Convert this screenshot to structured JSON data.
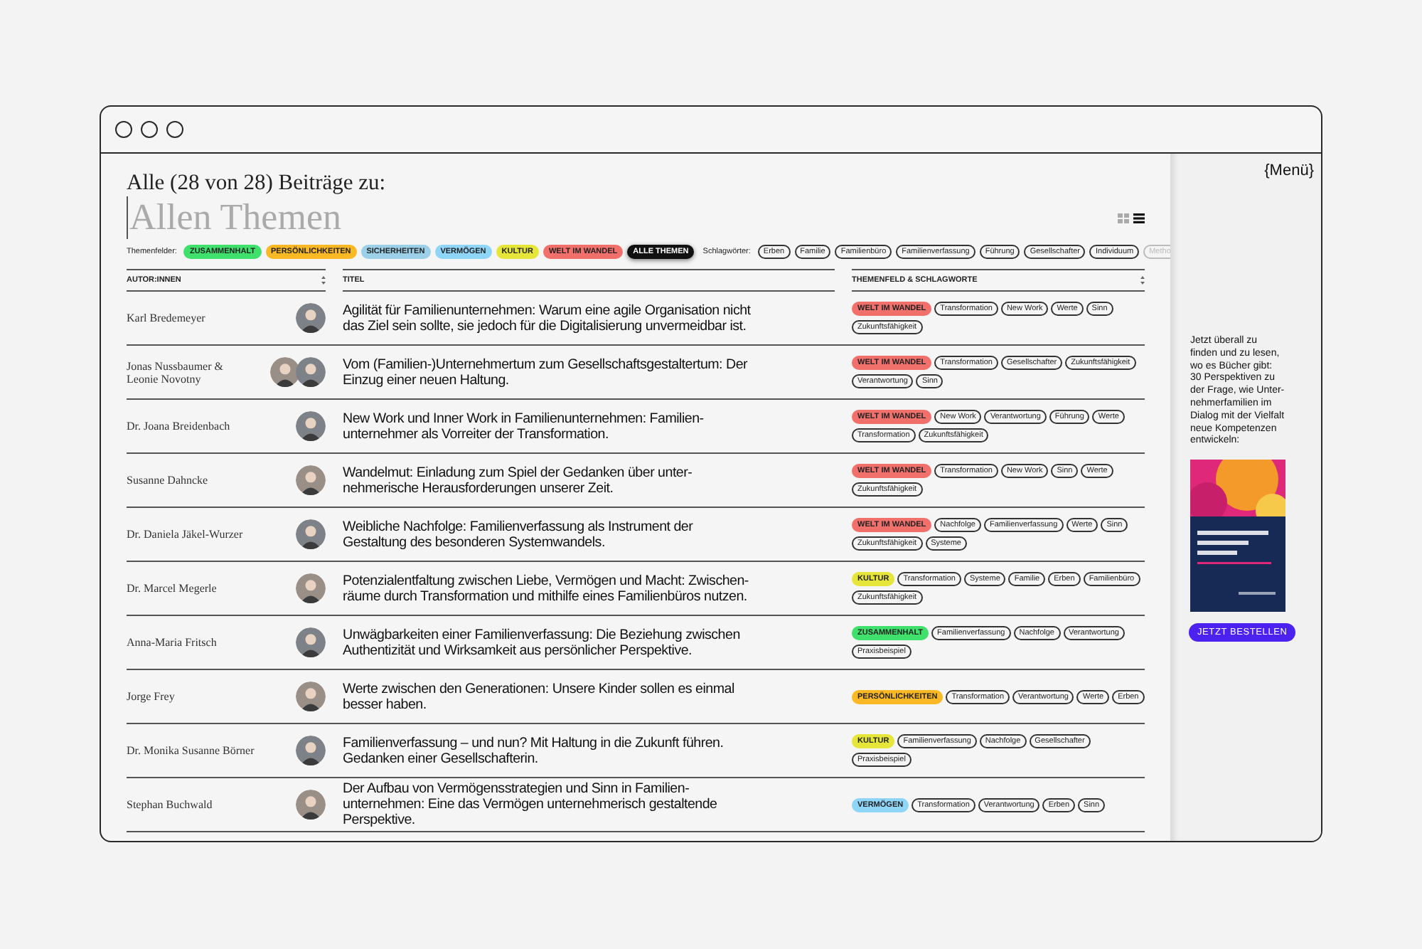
{
  "heading": "Alle (28 von 28) Beiträge zu:",
  "topic": "Allen Themen",
  "view_toggle": [
    {
      "kind": "grid",
      "selected": false
    },
    {
      "kind": "list",
      "selected": true
    }
  ],
  "theme_filter": {
    "label": "Themenfelder:",
    "items": [
      {
        "label": "ZUSAMMENHALT",
        "color": "#3fe06c",
        "selected": false
      },
      {
        "label": "PERSÖNLICHKEITEN",
        "color": "#f9b824",
        "selected": false
      },
      {
        "label": "SICHERHEITEN",
        "color": "#9ccfe8",
        "selected": false
      },
      {
        "label": "VERMÖGEN",
        "color": "#8fd5f8",
        "selected": false
      },
      {
        "label": "KULTUR",
        "color": "#e6e63a",
        "selected": false
      },
      {
        "label": "WELT IM WANDEL",
        "color": "#f2706c",
        "selected": false
      },
      {
        "label": "ALLE THEMEN",
        "color": "#111111",
        "selected": true
      }
    ]
  },
  "keyword_filter": {
    "label": "Schlagwörter:",
    "items": [
      {
        "label": "Erben",
        "faded": false
      },
      {
        "label": "Familie",
        "faded": false
      },
      {
        "label": "Familienbüro",
        "faded": false
      },
      {
        "label": "Familienverfassung",
        "faded": false
      },
      {
        "label": "Führung",
        "faded": false
      },
      {
        "label": "Gesellschafter",
        "faded": false
      },
      {
        "label": "Individuum",
        "faded": false
      },
      {
        "label": "Metho",
        "faded": true
      }
    ]
  },
  "table": {
    "columns": [
      {
        "label": "AUTOR:INNEN",
        "sortable": true
      },
      {
        "label": "TITEL",
        "sortable": false
      },
      {
        "label": "THEMENFELD & SCHLAGWORTE",
        "sortable": true
      }
    ],
    "rows": [
      {
        "author": "Karl Bredemeyer",
        "avatars": [
          {
            "kind": "person"
          }
        ],
        "title_lines": [
          "Agilität für Familienunternehmen: Warum eine agile Organisation nicht",
          "das Ziel sein sollte, sie jedoch für die Digitalisierung unvermeidbar ist."
        ],
        "theme": {
          "label": "WELT IM WANDEL",
          "color": "#f2706c"
        },
        "tags": [
          "Transformation",
          "New Work",
          "Werte",
          "Sinn",
          "Zukunftsfähigkeit"
        ]
      },
      {
        "author": "Jonas Nussbaumer & Leonie Novotny",
        "avatars": [
          {
            "kind": "person"
          },
          {
            "kind": "person"
          }
        ],
        "title_lines": [
          "Vom (Familien-)Unternehmertum zum Gesellschaftsgestaltertum: Der",
          "Einzug einer neuen Haltung."
        ],
        "theme": {
          "label": "WELT IM WANDEL",
          "color": "#f2706c"
        },
        "tags": [
          "Transformation",
          "Gesellschafter",
          "Zukunftsfähigkeit",
          "Verantwortung",
          "Sinn"
        ]
      },
      {
        "author": "Dr. Joana Breidenbach",
        "avatars": [
          {
            "kind": "person"
          }
        ],
        "title_lines": [
          "New Work und Inner Work in Familienunternehmen: Familien-",
          "unternehmer als Vorreiter der Transformation."
        ],
        "theme": {
          "label": "WELT IM WANDEL",
          "color": "#f2706c"
        },
        "tags": [
          "New Work",
          "Verantwortung",
          "Führung",
          "Werte",
          "Transformation",
          "Zukunftsfähigkeit"
        ]
      },
      {
        "author": "Susanne Dahncke",
        "avatars": [
          {
            "kind": "person"
          }
        ],
        "title_lines": [
          "Wandelmut: Einladung zum Spiel der Gedanken über unter-",
          "nehmerische Herausforderungen unserer Zeit."
        ],
        "theme": {
          "label": "WELT IM WANDEL",
          "color": "#f2706c"
        },
        "tags": [
          "Transformation",
          "New Work",
          "Sinn",
          "Werte",
          "Zukunftsfähigkeit"
        ]
      },
      {
        "author": "Dr. Daniela Jäkel-Wurzer",
        "avatars": [
          {
            "kind": "person"
          }
        ],
        "title_lines": [
          "Weibliche Nachfolge: Familienverfassung als Instrument der",
          "Gestaltung des besonderen Systemwandels."
        ],
        "theme": {
          "label": "WELT IM WANDEL",
          "color": "#f2706c"
        },
        "tags": [
          "Nachfolge",
          "Familienverfassung",
          "Werte",
          "Sinn",
          "Zukunftsfähigkeit",
          "Systeme"
        ]
      },
      {
        "author": "Dr. Marcel Megerle",
        "avatars": [
          {
            "kind": "person"
          }
        ],
        "title_lines": [
          "Potenzialentfaltung zwischen Liebe, Vermögen und Macht: Zwischen-",
          "räume durch Transformation und mithilfe eines Familienbüros nutzen."
        ],
        "theme": {
          "label": "KULTUR",
          "color": "#e6e63a"
        },
        "tags": [
          "Transformation",
          "Systeme",
          "Familie",
          "Erben",
          "Familienbüro",
          "Zukunftsfähigkeit"
        ]
      },
      {
        "author": "Anna-Maria Fritsch",
        "avatars": [
          {
            "kind": "person"
          }
        ],
        "title_lines": [
          "Unwägbarkeiten einer Familienverfassung: Die Beziehung zwischen",
          "Authentizität und Wirksamkeit aus persönlicher Perspektive."
        ],
        "theme": {
          "label": "ZUSAMMENHALT",
          "color": "#3fe06c"
        },
        "tags": [
          "Familienverfassung",
          "Nachfolge",
          "Verantwortung",
          "Praxisbeispiel"
        ]
      },
      {
        "author": "Jorge Frey",
        "avatars": [
          {
            "kind": "person"
          }
        ],
        "title_lines": [
          "Werte zwischen den Generationen: Unsere Kinder sollen es einmal",
          "besser haben."
        ],
        "theme": {
          "label": "PERSÖNLICHKEITEN",
          "color": "#f9b824"
        },
        "tags": [
          "Transformation",
          "Verantwortung",
          "Werte",
          "Erben"
        ]
      },
      {
        "author": "Dr. Monika Susanne Börner",
        "avatars": [
          {
            "kind": "person"
          }
        ],
        "title_lines": [
          "Familienverfassung – und nun? Mit Haltung in die Zukunft führen.",
          "Gedanken einer Gesellschafterin."
        ],
        "theme": {
          "label": "KULTUR",
          "color": "#e6e63a"
        },
        "tags": [
          "Familienverfassung",
          "Nachfolge",
          "Gesellschafter",
          "Praxisbeispiel"
        ]
      },
      {
        "author": "Stephan Buchwald",
        "avatars": [
          {
            "kind": "person"
          }
        ],
        "title_lines": [
          "Der Aufbau von Vermögensstrategien und Sinn in Familien-",
          "unternehmen: Eine das Vermögen unternehmerisch gestaltende",
          "Perspektive."
        ],
        "theme": {
          "label": "VERMÖGEN",
          "color": "#8fd5f8"
        },
        "tags": [
          "Transformation",
          "Verantwortung",
          "Erben",
          "Sinn"
        ]
      }
    ]
  },
  "sidebar": {
    "menu": "{Menü}",
    "promo_lines": [
      "Jetzt überall zu",
      "finden und zu lesen,",
      "wo es Bücher gibt:",
      "30 Perspektiven zu",
      "der Frage, wie Unter-",
      "nehmerfamilien im",
      "Dialog mit der Vielfalt",
      "neue Kompetenzen",
      "entwickeln:"
    ],
    "book": {
      "kind": "picture"
    },
    "order_button": "JETZT BESTELLEN"
  }
}
